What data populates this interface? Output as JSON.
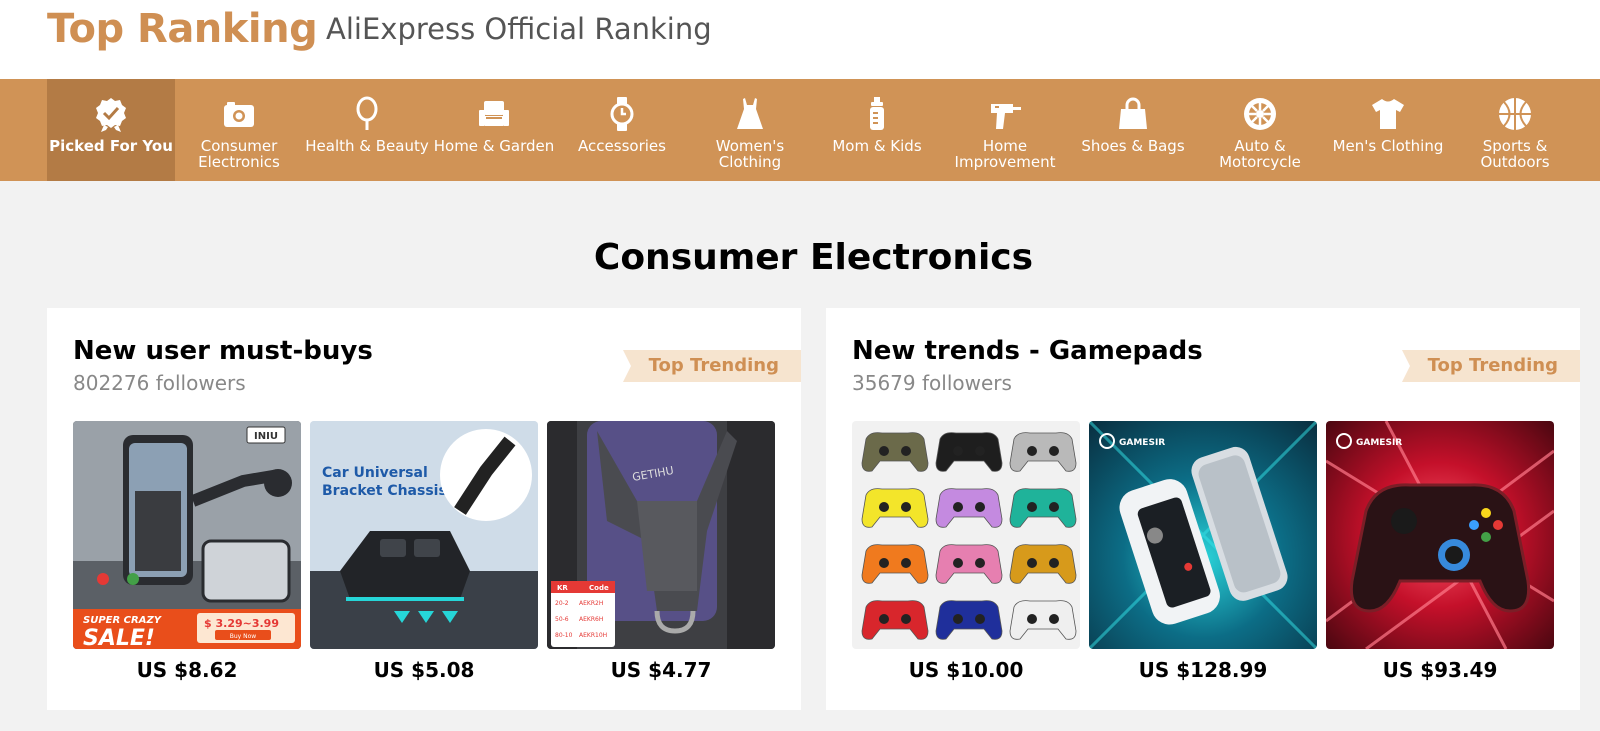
{
  "header": {
    "title": "Top Ranking",
    "subtitle": "AliExpress Official Ranking"
  },
  "categories": [
    {
      "label": "Picked For You",
      "icon": "badge-check-icon",
      "active": true
    },
    {
      "label": "Consumer Electronics",
      "icon": "camera-icon"
    },
    {
      "label": "Health & Beauty",
      "icon": "mirror-icon"
    },
    {
      "label": "Home & Garden",
      "icon": "sofa-icon"
    },
    {
      "label": "Accessories",
      "icon": "watch-icon"
    },
    {
      "label": "Women's Clothing",
      "icon": "dress-icon"
    },
    {
      "label": "Mom & Kids",
      "icon": "baby-bottle-icon"
    },
    {
      "label": "Home Improvement",
      "icon": "drill-icon"
    },
    {
      "label": "Shoes & Bags",
      "icon": "bag-icon"
    },
    {
      "label": "Auto & Motorcycle",
      "icon": "wheel-icon"
    },
    {
      "label": "Men's Clothing",
      "icon": "tshirt-icon"
    },
    {
      "label": "Sports & Outdoors",
      "icon": "ball-icon"
    }
  ],
  "section": {
    "title": "Consumer Electronics"
  },
  "cards": [
    {
      "title": "New user must-buys",
      "followers": "802276 followers",
      "badge": "Top Trending",
      "products": [
        {
          "price": "US $8.62",
          "image_text": [
            "INIU",
            "SUPER CRAZY",
            "SALE!",
            "$ 3.29~3.99",
            "Buy Now"
          ]
        },
        {
          "price": "US $5.08",
          "image_text": [
            "Car Universal",
            "Bracket Chassis"
          ]
        },
        {
          "price": "US $4.77",
          "image_text": [
            "GETIHU",
            "KR",
            "Code",
            "20-2",
            "AEKR2H",
            "50-6",
            "AEKR6H",
            "80-10",
            "AEKR10H"
          ]
        }
      ]
    },
    {
      "title": "New trends - Gamepads",
      "followers": "35679 followers",
      "badge": "Top Trending",
      "products": [
        {
          "price": "US $10.00",
          "image_text": []
        },
        {
          "price": "US $128.99",
          "image_text": [
            "GAMESIR"
          ]
        },
        {
          "price": "US $93.49",
          "image_text": [
            "GAMESIR"
          ]
        }
      ]
    }
  ],
  "colors": {
    "brand": "#cf8f53",
    "category_bar": "#d09356",
    "category_active": "#b37b45",
    "badge_bg": "#f6e4cf",
    "page_bg": "#f2f2f2"
  }
}
